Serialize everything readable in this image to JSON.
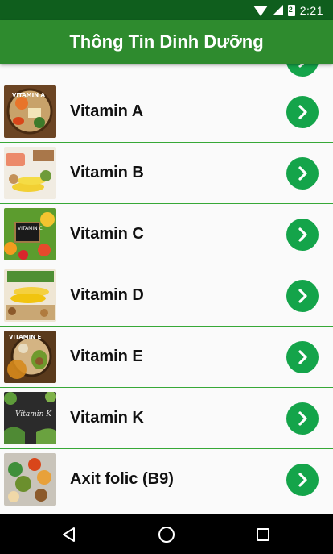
{
  "status_bar": {
    "battery_text": "2",
    "time": "2:21"
  },
  "app_bar": {
    "title": "Thông Tin Dinh Dưỡng"
  },
  "list": {
    "items": [
      {
        "label": "Vitamin A",
        "thumb_text": "VITAMIN A"
      },
      {
        "label": "Vitamin B",
        "thumb_text": ""
      },
      {
        "label": "Vitamin C",
        "thumb_text": "VITAMIN C"
      },
      {
        "label": "Vitamin D",
        "thumb_text": ""
      },
      {
        "label": "Vitamin E",
        "thumb_text": "VITAMIN E"
      },
      {
        "label": "Vitamin K",
        "thumb_text": "Vitamin K"
      },
      {
        "label": "Axit folic (B9)",
        "thumb_text": ""
      }
    ]
  },
  "colors": {
    "status_bar": "#0f5e1d",
    "app_bar": "#2e8b2e",
    "divider": "#37a837",
    "go_button": "#14a44a"
  },
  "icons": {
    "row_action": "chevron-right-icon",
    "nav_back": "back-triangle-icon",
    "nav_home": "home-circle-icon",
    "nav_recent": "recents-square-icon"
  }
}
